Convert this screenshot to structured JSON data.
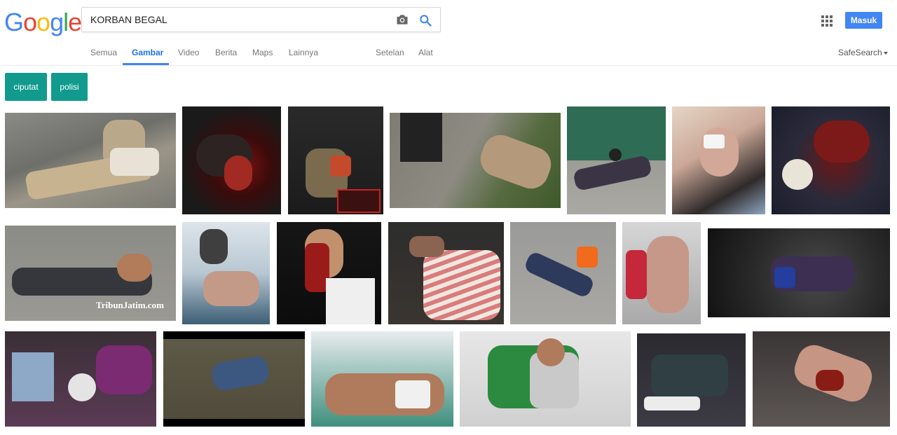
{
  "logo": {
    "letters": [
      "G",
      "o",
      "o",
      "g",
      "l",
      "e"
    ],
    "colors": [
      "#4285f4",
      "#ea4335",
      "#fbbc05",
      "#4285f4",
      "#34a853",
      "#ea4335"
    ]
  },
  "search": {
    "value": "KORBAN BEGAL",
    "camera_icon": "camera-icon",
    "search_icon": "search-icon"
  },
  "header": {
    "apps_icon": "apps-grid-icon",
    "signin_label": "Masuk",
    "signin_color": "#4285f4"
  },
  "nav": {
    "tabs": [
      {
        "label": "Semua",
        "active": false
      },
      {
        "label": "Gambar",
        "active": true
      },
      {
        "label": "Video",
        "active": false
      },
      {
        "label": "Berita",
        "active": false
      },
      {
        "label": "Maps",
        "active": false
      },
      {
        "label": "Lainnya",
        "active": false
      }
    ],
    "settings_label": "Setelan",
    "tools_label": "Alat",
    "safesearch_label": "SafeSearch"
  },
  "chips": [
    {
      "label": "ciputat",
      "color": "#119a8d"
    },
    {
      "label": "polisi",
      "color": "#119a8d"
    }
  ],
  "images": {
    "rows": 3,
    "thumbnail_count": 21,
    "watermark_text": "TribunJatim.com"
  },
  "colors": {
    "accent": "#4285f4",
    "active_tab": "#1a73e8",
    "chip": "#119a8d"
  }
}
